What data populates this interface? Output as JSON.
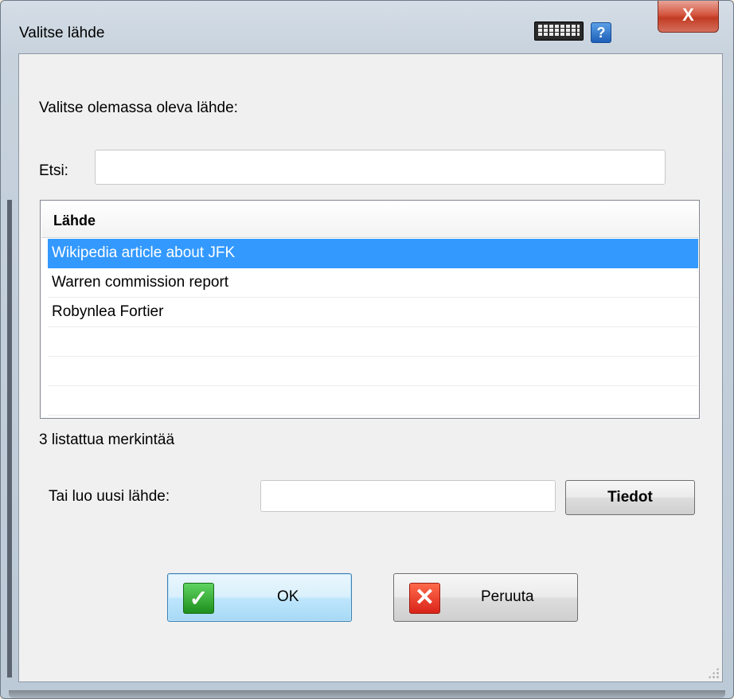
{
  "window": {
    "title": "Valitse lähde",
    "close_glyph": "X",
    "help_glyph": "?"
  },
  "dialog": {
    "prompt": "Valitse olemassa oleva lähde:",
    "search": {
      "label": "Etsi:",
      "value": "",
      "placeholder": ""
    },
    "list": {
      "header": "Lähde",
      "rows": [
        {
          "label": "Wikipedia article about JFK",
          "selected": true
        },
        {
          "label": "Warren commission report",
          "selected": false
        },
        {
          "label": "Robynlea Fortier",
          "selected": false
        },
        {
          "label": "",
          "selected": false
        },
        {
          "label": "",
          "selected": false
        },
        {
          "label": "",
          "selected": false
        }
      ]
    },
    "count_text": "3 listattua merkintää",
    "new_source": {
      "label": "Tai luo uusi lähde:",
      "value": "",
      "details_label": "Tiedot"
    },
    "buttons": {
      "ok_label": "OK",
      "ok_icon": "check-icon",
      "cancel_label": "Peruuta",
      "cancel_icon": "x-icon"
    }
  },
  "colors": {
    "selection": "#3399ff",
    "ok_icon": "#2aa52a",
    "cancel_icon": "#e0321f",
    "help_icon": "#1d6fd1"
  }
}
